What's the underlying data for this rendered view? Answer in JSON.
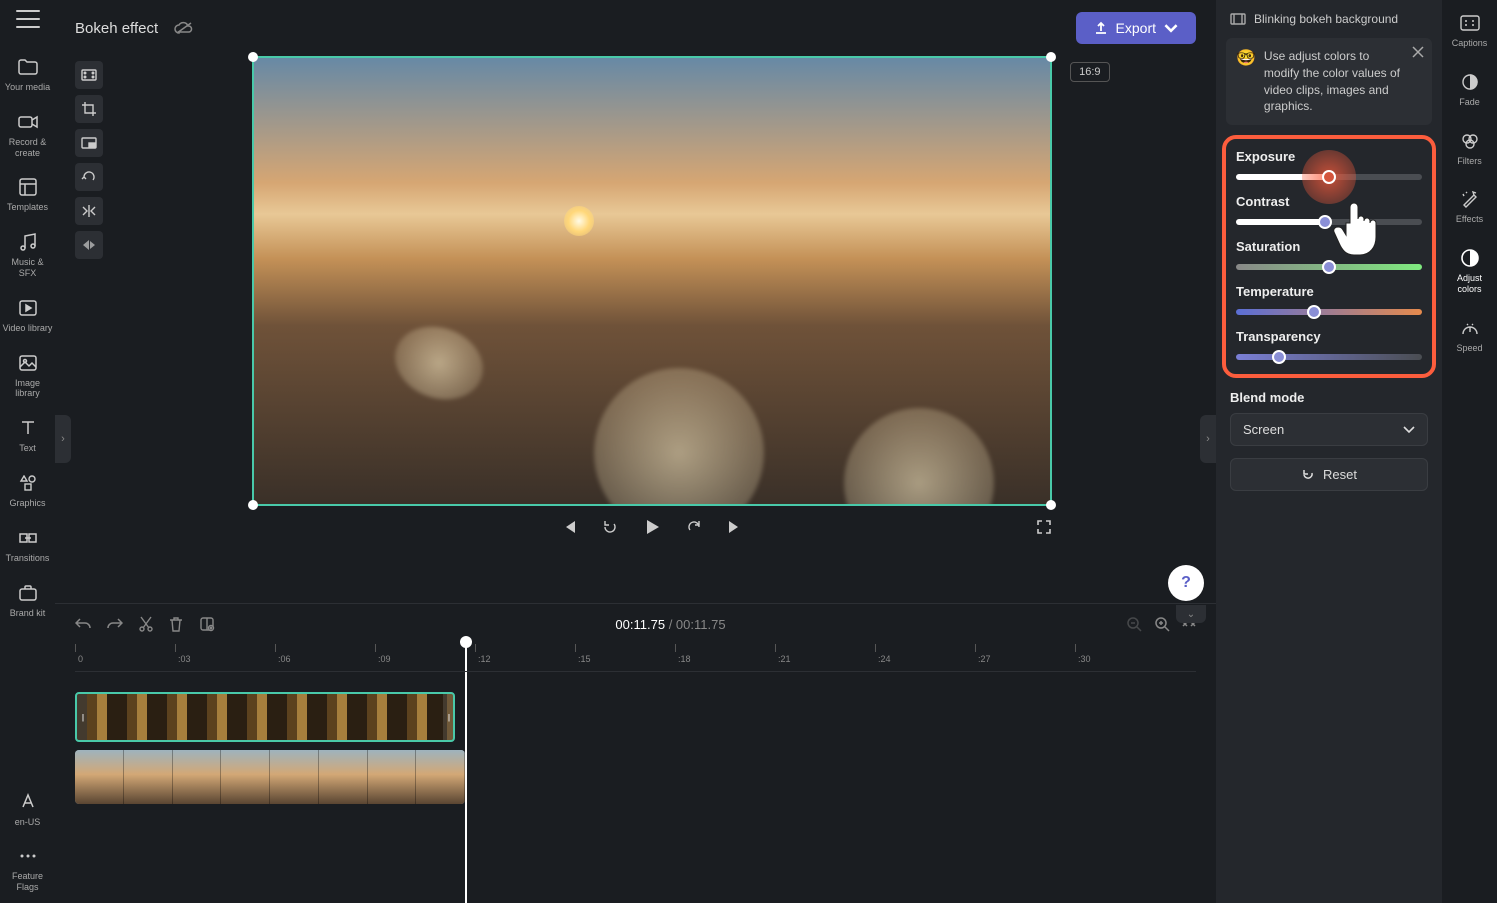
{
  "header": {
    "project_title": "Bokeh effect",
    "export_label": "Export",
    "aspect_ratio": "16:9"
  },
  "left_sidebar": {
    "items": [
      {
        "label": "Your media"
      },
      {
        "label": "Record & create"
      },
      {
        "label": "Templates"
      },
      {
        "label": "Music & SFX"
      },
      {
        "label": "Video library"
      },
      {
        "label": "Image library"
      },
      {
        "label": "Text"
      },
      {
        "label": "Graphics"
      },
      {
        "label": "Transitions"
      },
      {
        "label": "Brand kit"
      }
    ],
    "bottom": [
      {
        "label": "en-US"
      },
      {
        "label": "Feature Flags"
      }
    ]
  },
  "timeline": {
    "current_time": "00:11.75",
    "total_time": "00:11.75",
    "ruler": [
      "0",
      ":03",
      ":06",
      ":09",
      ":12",
      ":15",
      ":18",
      ":21",
      ":24",
      ":27",
      ":30"
    ]
  },
  "right_panel": {
    "clip_name": "Blinking bokeh background",
    "tip": "Use adjust colors to modify the color values of video clips, images and graphics.",
    "sliders": {
      "exposure": {
        "label": "Exposure",
        "pos": 50
      },
      "contrast": {
        "label": "Contrast",
        "pos": 48
      },
      "saturation": {
        "label": "Saturation",
        "pos": 50
      },
      "temperature": {
        "label": "Temperature",
        "pos": 42
      },
      "transparency": {
        "label": "Transparency",
        "pos": 23
      }
    },
    "blend_mode": {
      "label": "Blend mode",
      "value": "Screen"
    },
    "reset_label": "Reset"
  },
  "far_right": {
    "items": [
      {
        "label": "Captions"
      },
      {
        "label": "Fade"
      },
      {
        "label": "Filters"
      },
      {
        "label": "Effects"
      },
      {
        "label": "Adjust colors"
      },
      {
        "label": "Speed"
      }
    ]
  },
  "colors": {
    "accent": "#5b5fc7",
    "highlight": "#fc5d3d",
    "selection": "#49c9a9"
  }
}
